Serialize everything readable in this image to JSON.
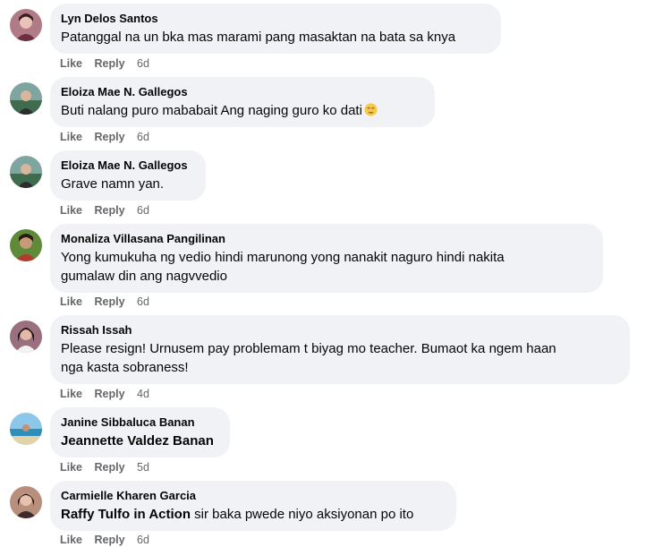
{
  "comments": [
    {
      "author": "Lyn Delos Santos",
      "text": "Patanggal na un bka mas marami pang masaktan na bata sa knya",
      "like": "Like",
      "reply": "Reply",
      "time": "6d"
    },
    {
      "author": "Eloiza Mae N. Gallegos",
      "text": "Buti nalang puro mababait Ang naging guro ko dati",
      "emoji": "relieved-face-emoji",
      "like": "Like",
      "reply": "Reply",
      "time": "6d"
    },
    {
      "author": "Eloiza Mae N. Gallegos",
      "text": "Grave namn yan.",
      "like": "Like",
      "reply": "Reply",
      "time": "6d"
    },
    {
      "author": "Monaliza Villasana Pangilinan",
      "text_line1": "Yong kumukuha ng vedio hindi marunong yong nanakit naguro hindi nakita",
      "text_line2": "gumalaw din ang nagvvedio",
      "like": "Like",
      "reply": "Reply",
      "time": "6d"
    },
    {
      "author": "Rissah Issah",
      "text_line1": "Please resign! Urnusem pay problemam t biyag mo teacher. Bumaot ka ngem haan",
      "text_line2": "nga kasta sobraness!",
      "like": "Like",
      "reply": "Reply",
      "time": "4d"
    },
    {
      "author": "Janine Sibbaluca Banan",
      "mention": "Jeannette Valdez Banan",
      "like": "Like",
      "reply": "Reply",
      "time": "5d"
    },
    {
      "author": "Carmielle Kharen Garcia",
      "mention": "Raffy Tulfo in Action",
      "text": " sir baka pwede niyo aksiyonan po ito",
      "like": "Like",
      "reply": "Reply",
      "time": "6d"
    }
  ],
  "colors": {
    "bubble": "#f0f2f5",
    "text": "#050505",
    "meta": "#65676b"
  }
}
